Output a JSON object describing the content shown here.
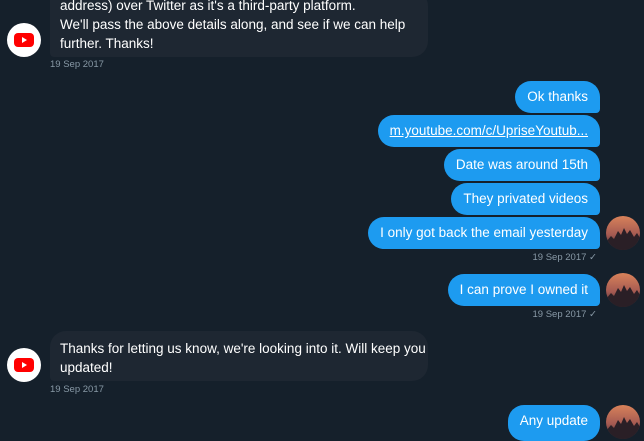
{
  "conversation": {
    "messages": [
      {
        "sender": "YouTube",
        "direction": "incoming",
        "lines": [
          "address) over Twitter as it's a third-party platform.",
          "We'll pass the above details along, and see if we can help",
          "further. Thanks!"
        ],
        "timestamp": "19 Sep 2017"
      },
      {
        "direction": "outgoing",
        "text": "Ok thanks"
      },
      {
        "direction": "outgoing",
        "text": "m.youtube.com/c/UpriseYoutub...",
        "is_link": true
      },
      {
        "direction": "outgoing",
        "text": "Date was around 15th"
      },
      {
        "direction": "outgoing",
        "text": "They privated videos"
      },
      {
        "direction": "outgoing",
        "text": "I only got back the email yesterday",
        "timestamp": "19 Sep 2017 ✓"
      },
      {
        "direction": "outgoing",
        "text": "I can prove I owned it",
        "timestamp": "19 Sep 2017 ✓"
      },
      {
        "sender": "YouTube",
        "direction": "incoming",
        "lines": [
          "Thanks for letting us know, we're looking into it. Will keep you",
          "updated!"
        ],
        "timestamp": "19 Sep 2017"
      },
      {
        "direction": "outgoing",
        "text": "Any update"
      }
    ]
  },
  "icons": {
    "incoming_avatar": "youtube-logo-icon",
    "outgoing_avatar": "user-photo-avatar",
    "read_receipt": "checkmark-icon"
  },
  "colors": {
    "background": "#15202b",
    "incoming_bubble": "#1e2732",
    "outgoing_bubble": "#1d9bf0",
    "timestamp_text": "#8899a6",
    "youtube_red": "#ff0000"
  }
}
